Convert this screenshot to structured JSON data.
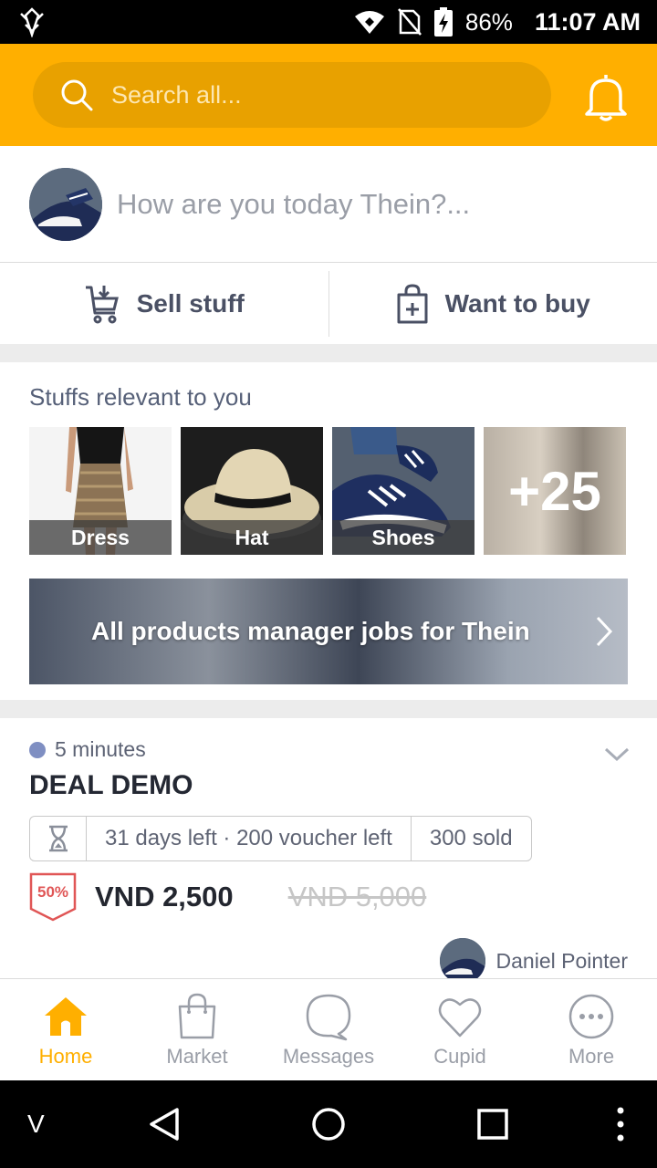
{
  "status_bar": {
    "battery": "86%",
    "time": "11:07 AM"
  },
  "header": {
    "search_placeholder": "Search all..."
  },
  "composer": {
    "prompt": "How are you today Thein?..."
  },
  "actions": {
    "sell_label": "Sell stuff",
    "buy_label": "Want to buy"
  },
  "relevant": {
    "title": "Stuffs relevant to you",
    "tiles": [
      {
        "label": "Dress"
      },
      {
        "label": "Hat"
      },
      {
        "label": "Shoes"
      },
      {
        "label": "+25"
      }
    ]
  },
  "jobs_banner": {
    "text": "All products manager jobs for Thein"
  },
  "deal": {
    "time_ago": "5 minutes",
    "title": "DEAL DEMO",
    "days_vouchers": "31 days left · 200 voucher left",
    "sold": "300 sold",
    "discount": "50%",
    "price": "VND 2,500",
    "old_price": "VND 5,000",
    "seller": "Daniel Pointer"
  },
  "bottom_nav": {
    "items": [
      {
        "label": "Home"
      },
      {
        "label": "Market"
      },
      {
        "label": "Messages"
      },
      {
        "label": "Cupid"
      },
      {
        "label": "More"
      }
    ]
  },
  "system_nav": {
    "left_label": "V"
  },
  "colors": {
    "brand": "#ffaf00",
    "search_bg": "#e8a100",
    "discount": "#e05656"
  }
}
